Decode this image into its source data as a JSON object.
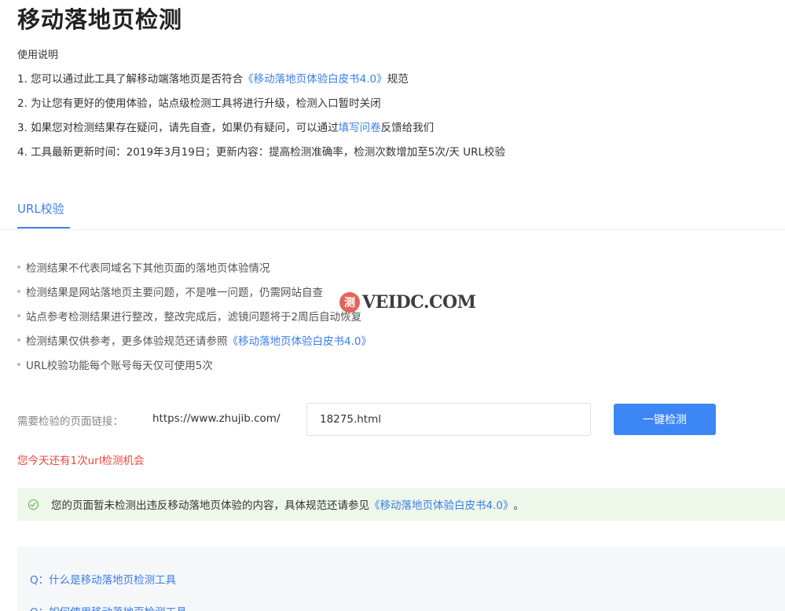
{
  "page": {
    "title": "移动落地页检测"
  },
  "instructions": {
    "heading": "使用说明",
    "line1": {
      "before": "1. 您可以通过此工具了解移动端落地页是否符合",
      "link": "《移动落地页体验白皮书4.0》",
      "after": "规范"
    },
    "line2": {
      "text": "2. 为让您有更好的使用体验，站点级检测工具将进行升级，检测入口暂时关闭"
    },
    "line3": {
      "before": "3. 如果您对检测结果存在疑问，请先自查，如果仍有疑问，可以通过",
      "link": "填写问卷",
      "after": "反馈给我们"
    },
    "line4": {
      "text": "4. 工具最新更新时间：2019年3月19日；更新内容：提高检测准确率，检测次数增加至5次/天 URL校验"
    }
  },
  "tabs": {
    "active": "URL校验"
  },
  "notes": {
    "n1": "检测结果不代表同域名下其他页面的落地页体验情况",
    "n2": "检测结果是网站落地页主要问题，不是唯一问题，仍需网站自查",
    "n3": "站点参考检测结果进行整改，整改完成后，滤镜问题将于2周后自动恢复",
    "n4_before": "检测结果仅供参考，更多体验规范还请参照",
    "n4_link": "《移动落地页体验白皮书4.0》",
    "n5": "URL校验功能每个账号每天仅可使用5次"
  },
  "form": {
    "label": "需要检验的页面链接：",
    "prefix": "https://www.zhujib.com/",
    "value": "18275.html",
    "button": "一键检测",
    "remaining": "您今天还有1次url检测机会"
  },
  "result": {
    "icon": "check-circle-icon",
    "before": "您的页面暂未检测出违反移动落地页体验的内容，具体规范还请参见",
    "link": "《移动落地页体验白皮书4.0》",
    "after": "。"
  },
  "faq": {
    "q1": "Q：什么是移动落地页检测工具",
    "q2": "Q：如何使用移动落地页检测工具"
  },
  "watermark": {
    "badge": "测",
    "text": "VEIDC.COM"
  },
  "colors": {
    "accent": "#3b7ee8",
    "button": "#3d86f5",
    "warning": "#e8483b",
    "success": "#52b344",
    "success_bg": "#eef7ea"
  }
}
